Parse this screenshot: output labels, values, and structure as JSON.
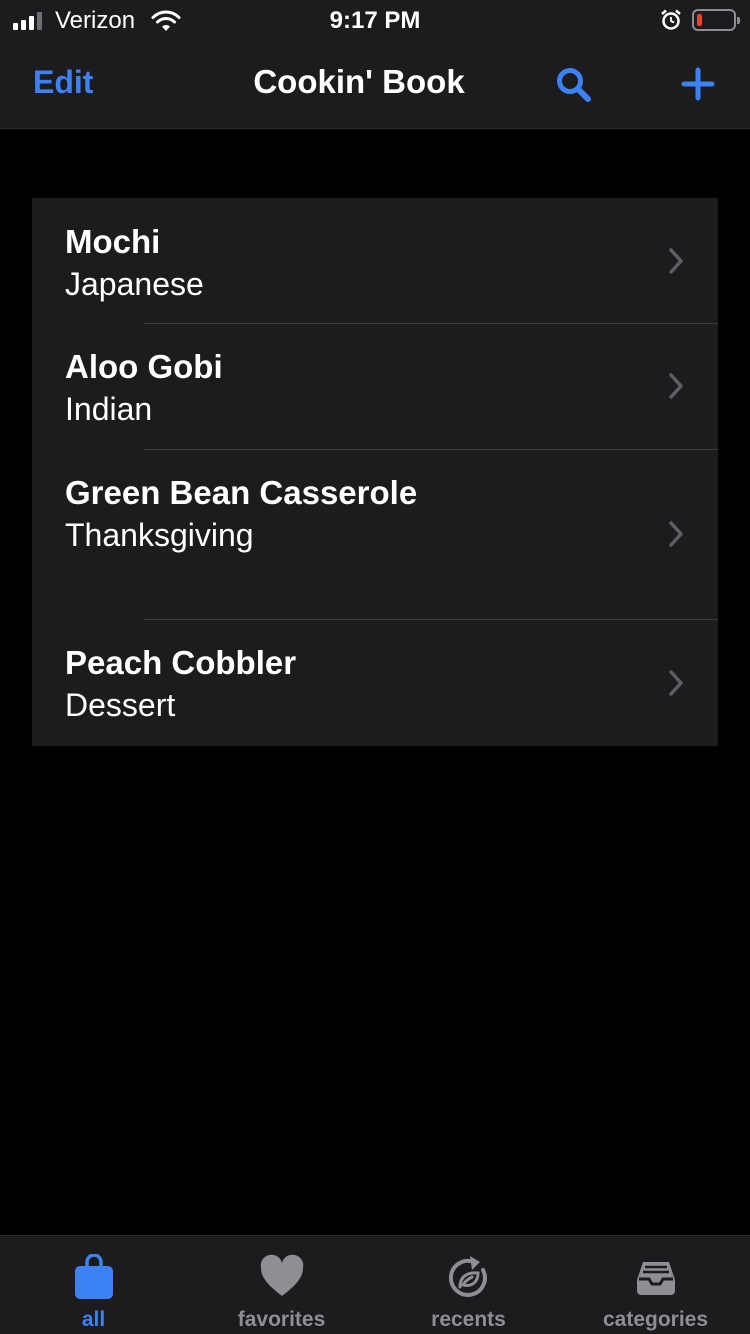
{
  "status_bar": {
    "carrier": "Verizon",
    "time": "9:17 PM"
  },
  "nav": {
    "edit_label": "Edit",
    "title": "Cookin' Book",
    "search_icon": "search-icon",
    "add_icon": "plus-icon"
  },
  "recipes": [
    {
      "name": "Mochi",
      "category": "Japanese"
    },
    {
      "name": "Aloo Gobi",
      "category": "Indian"
    },
    {
      "name": "Green Bean Casserole",
      "category": "Thanksgiving"
    },
    {
      "name": "Peach Cobbler",
      "category": "Dessert"
    }
  ],
  "tabs": [
    {
      "label": "all",
      "icon": "bag-icon",
      "active": true
    },
    {
      "label": "favorites",
      "icon": "heart-icon",
      "active": false
    },
    {
      "label": "recents",
      "icon": "recents-icon",
      "active": false
    },
    {
      "label": "categories",
      "icon": "tray-icon",
      "active": false
    }
  ],
  "colors": {
    "accent": "#3d82f4",
    "background": "#000000",
    "surface": "#1c1c1e",
    "inactive": "#8e8e93"
  }
}
